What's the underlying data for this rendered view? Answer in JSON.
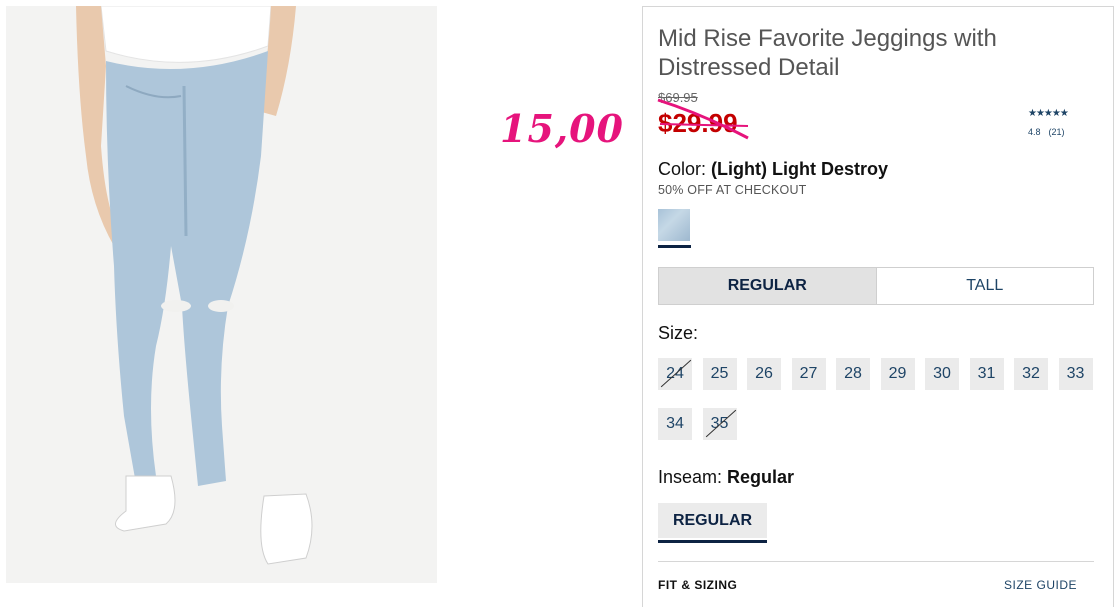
{
  "handwritten_note": "15,00",
  "product": {
    "title": "Mid Rise Favorite Jeggings with Distressed Detail",
    "original_price": "$69.95",
    "sale_price": "$29.99",
    "rating_stars": "★★★★★",
    "rating_value": "4.8",
    "review_count": "(21)"
  },
  "color": {
    "label": "Color:",
    "value": "(Light) Light Destroy",
    "promo": "50% OFF AT CHECKOUT",
    "swatch_color": "#b3cadd"
  },
  "fit": {
    "options": [
      "REGULAR",
      "TALL"
    ],
    "selected": "REGULAR"
  },
  "size": {
    "label": "Size:",
    "options": [
      {
        "label": "24",
        "available": false
      },
      {
        "label": "25",
        "available": true
      },
      {
        "label": "26",
        "available": true
      },
      {
        "label": "27",
        "available": true
      },
      {
        "label": "28",
        "available": true
      },
      {
        "label": "29",
        "available": true
      },
      {
        "label": "30",
        "available": true
      },
      {
        "label": "31",
        "available": true
      },
      {
        "label": "32",
        "available": true
      },
      {
        "label": "33",
        "available": true
      },
      {
        "label": "34",
        "available": true
      },
      {
        "label": "35",
        "available": false
      }
    ]
  },
  "inseam": {
    "label": "Inseam:",
    "value": "Regular",
    "button": "REGULAR"
  },
  "footer": {
    "fit_sizing": "FIT & SIZING",
    "size_guide": "SIZE GUIDE"
  },
  "colors": {
    "sale": "#c30000",
    "navy": "#0d2343",
    "link": "#1e4466",
    "annotation": "#e6147c"
  }
}
